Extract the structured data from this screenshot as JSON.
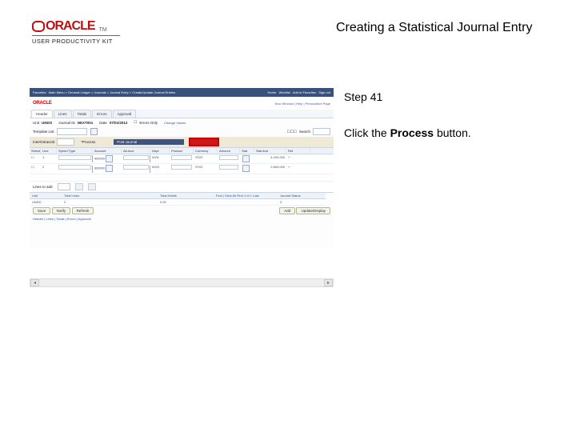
{
  "header": {
    "brand": "ORACLE",
    "subbrand": "USER PRODUCTIVITY KIT",
    "tm": "TM",
    "title": "Creating a Statistical Journal Entry"
  },
  "step": {
    "label": "Step 41",
    "text_pre": "Click the ",
    "text_bold": "Process",
    "text_post": " button."
  },
  "shot": {
    "topbar": {
      "left_items": [
        "Favorites",
        "Main Menu",
        "General Ledger",
        "Journals",
        "Journal Entry",
        "Create/Update Journal Entries"
      ],
      "right_items": [
        "Home",
        "Worklist",
        "Add to Favorites",
        "Sign out"
      ]
    },
    "brandrow": {
      "oracle": "ORACLE",
      "right": "New Window | Help | Personalize Page"
    },
    "tabs": [
      "Header",
      "Lines",
      "Totals",
      "Errors",
      "Approval"
    ],
    "row1": {
      "unit_lbl": "Unit",
      "unit_val": "UNDO",
      "jid_lbl": "Journal ID",
      "jid_val": "NEXT001",
      "date_lbl": "Date",
      "date_val": "07/01/2012",
      "eo_lbl": "Errors Only",
      "cj_lbl": "Change Values"
    },
    "row2": {
      "tmpl_lbl": "Template List",
      "chg_lbl": "Change Values",
      "search_lbl": "Search"
    },
    "row3": {
      "int_lbl": "Inter/IntraUnit",
      "proc_lbl": "*Process",
      "proc_val": "Post Journal"
    },
    "grid": {
      "cols": [
        "Select",
        "Line",
        "Speed Type",
        "Account",
        "Alt Acct",
        "Dept",
        "Product",
        "Currency",
        "Amount",
        "Stat",
        "Stat Amt",
        "Ref"
      ],
      "r1": [
        "",
        "1",
        "",
        "960000",
        "",
        "0001",
        "",
        "STAT",
        "",
        "",
        "4,200.000",
        "+"
      ],
      "r2": [
        "",
        "2",
        "",
        "960000",
        "",
        "0003",
        "",
        "STAT",
        "",
        "",
        "2,800.000",
        "+"
      ]
    },
    "lines_band": {
      "label": "Lines to add",
      "val": "1"
    },
    "totals": {
      "cols": [
        "Unit",
        "Total Lines",
        "Total Debits",
        "Find | View All  First 1 of 1 Last",
        "Journal Status"
      ],
      "vals": [
        "UNDO",
        "2",
        "0.00",
        "",
        "V"
      ]
    },
    "buttons": {
      "save": "Save",
      "notify": "Notify",
      "refresh": "Refresh",
      "add": "Add",
      "update": "Update/Display"
    },
    "footer_link": "Header | Lines | Totals | Errors | Approval"
  }
}
